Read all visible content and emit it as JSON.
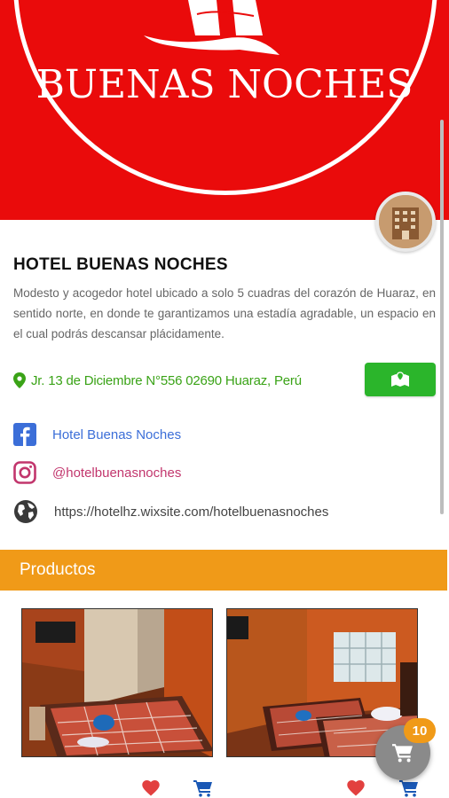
{
  "header": {
    "brand_text": "BUENAS NOCHES"
  },
  "hotel": {
    "name": "HOTEL BUENAS NOCHES",
    "description": "Modesto y acogedor hotel ubicado a solo 5 cuadras del corazón de Huaraz, en sentido norte, en donde te garantizamos una estadía agradable, un espacio en el cual podrás descansar plácidamente.",
    "address": "Jr. 13 de Diciembre N°556 02690 Huaraz, Perú"
  },
  "links": {
    "facebook": "Hotel Buenas Noches",
    "instagram": "@hotelbuenasnoches",
    "website": "https://hotelhz.wixsite.com/hotelbuenasnoches"
  },
  "section": {
    "title": "Productos"
  },
  "cart": {
    "count": "10"
  },
  "colors": {
    "banner": "#ea0b0b",
    "accent": "#f09a18",
    "green": "#2bb52b",
    "facebook": "#3b6ed8",
    "instagram": "#c2366d"
  },
  "icons": [
    "map-pin-icon",
    "map-icon",
    "facebook-icon",
    "instagram-icon",
    "globe-icon",
    "heart-icon",
    "cart-icon"
  ]
}
